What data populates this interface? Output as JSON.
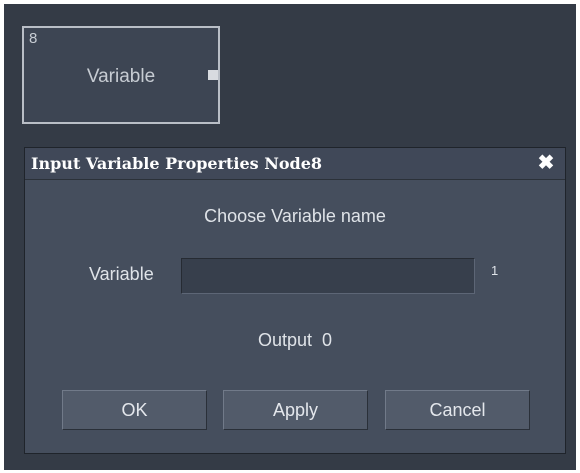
{
  "node": {
    "id": "8",
    "label": "Variable"
  },
  "dialog": {
    "title": "Input Variable Properties Node8",
    "close_glyph": "✖",
    "prompt": "Choose Variable name",
    "variable_label": "Variable",
    "variable_value": "",
    "variable_hint": "1",
    "output_text": "Output  0",
    "buttons": {
      "ok": "OK",
      "apply": "Apply",
      "cancel": "Cancel"
    }
  },
  "colors": {
    "canvas_bg": "#343b46",
    "dialog_bg": "#454e5d",
    "button_bg": "#525b6a",
    "text": "#dfe3e8"
  }
}
